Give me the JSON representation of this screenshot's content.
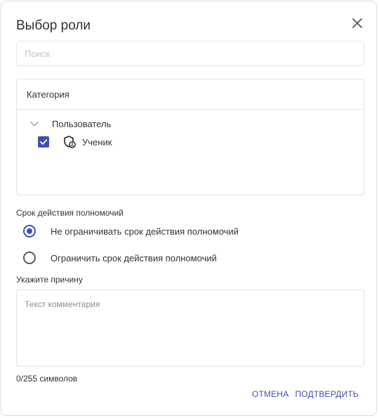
{
  "dialog": {
    "title": "Выбор роли",
    "close_icon": "close-icon"
  },
  "search": {
    "placeholder": "Поиск",
    "value": ""
  },
  "category": {
    "header": "Категория",
    "groups": [
      {
        "label": "Пользователь",
        "expanded": true,
        "items": [
          {
            "label": "Ученик",
            "checked": true,
            "icon": "shield-user-icon"
          }
        ]
      }
    ]
  },
  "term": {
    "label": "Срок действия полномочий",
    "options": [
      {
        "label": "Не ограничивать срок действия полномочий",
        "selected": true
      },
      {
        "label": "Ограничить срок действия полномочий",
        "selected": false
      }
    ]
  },
  "reason": {
    "label": "Укажите причину",
    "placeholder": "Текст комментария",
    "value": "",
    "counter": "0/255 символов"
  },
  "actions": {
    "cancel": "ОТМЕНА",
    "confirm": "ПОДТВЕРДИТЬ"
  },
  "colors": {
    "accent": "#3f51b5",
    "border": "#e2e2e2",
    "text": "#333333"
  }
}
